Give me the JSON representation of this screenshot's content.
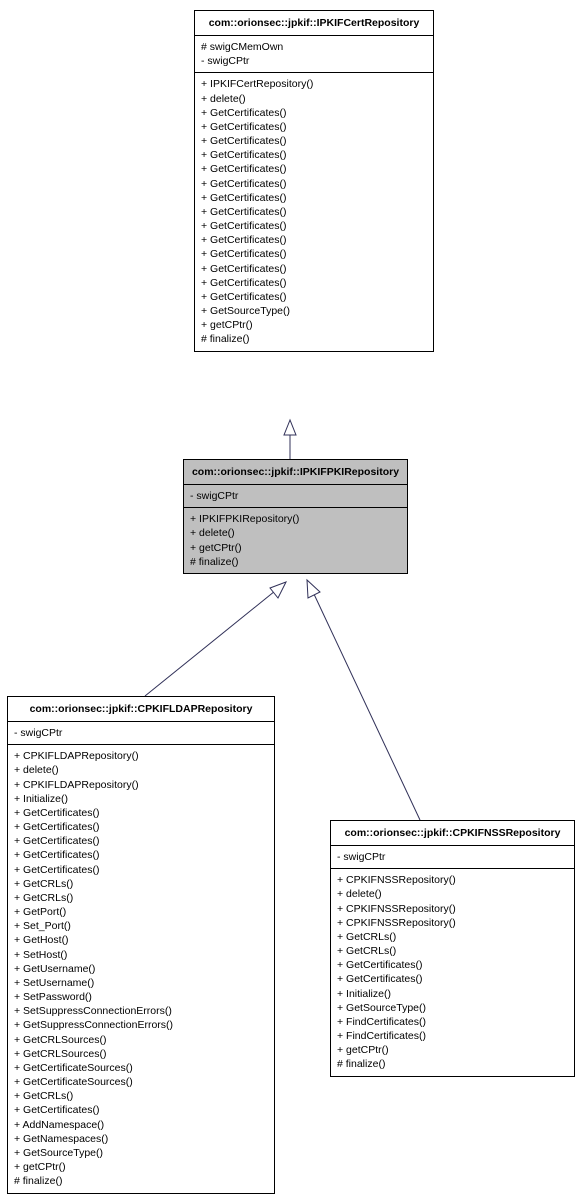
{
  "top": {
    "title": "com::orionsec::jpkif::IPKIFCertRepository",
    "attrs": [
      "# swigCMemOwn",
      "- swigCPtr"
    ],
    "ops": [
      "+ IPKIFCertRepository()",
      "+ delete()",
      "+ GetCertificates()",
      "+ GetCertificates()",
      "+ GetCertificates()",
      "+ GetCertificates()",
      "+ GetCertificates()",
      "+ GetCertificates()",
      "+ GetCertificates()",
      "+ GetCertificates()",
      "+ GetCertificates()",
      "+ GetCertificates()",
      "+ GetCertificates()",
      "+ GetCertificates()",
      "+ GetCertificates()",
      "+ GetCertificates()",
      "+ GetSourceType()",
      "+ getCPtr()",
      "# finalize()"
    ]
  },
  "mid": {
    "title": "com::orionsec::jpkif::IPKIFPKIRepository",
    "attrs": [
      "- swigCPtr"
    ],
    "ops": [
      "+ IPKIFPKIRepository()",
      "+ delete()",
      "+ getCPtr()",
      "# finalize()"
    ]
  },
  "left": {
    "title": "com::orionsec::jpkif::CPKIFLDAPRepository",
    "attrs": [
      "- swigCPtr"
    ],
    "ops": [
      "+ CPKIFLDAPRepository()",
      "+ delete()",
      "+ CPKIFLDAPRepository()",
      "+ Initialize()",
      "+ GetCertificates()",
      "+ GetCertificates()",
      "+ GetCertificates()",
      "+ GetCertificates()",
      "+ GetCertificates()",
      "+ GetCRLs()",
      "+ GetCRLs()",
      "+ GetPort()",
      "+ Set_Port()",
      "+ GetHost()",
      "+ SetHost()",
      "+ GetUsername()",
      "+ SetUsername()",
      "+ SetPassword()",
      "+ SetSuppressConnectionErrors()",
      "+ GetSuppressConnectionErrors()",
      "+ GetCRLSources()",
      "+ GetCRLSources()",
      "+ GetCertificateSources()",
      "+ GetCertificateSources()",
      "+ GetCRLs()",
      "+ GetCertificates()",
      "+ AddNamespace()",
      "+ GetNamespaces()",
      "+ GetSourceType()",
      "+ getCPtr()",
      "# finalize()"
    ]
  },
  "right": {
    "title": "com::orionsec::jpkif::CPKIFNSSRepository",
    "attrs": [
      "- swigCPtr"
    ],
    "ops": [
      "+ CPKIFNSSRepository()",
      "+ delete()",
      "+ CPKIFNSSRepository()",
      "+ CPKIFNSSRepository()",
      "+ GetCRLs()",
      "+ GetCRLs()",
      "+ GetCertificates()",
      "+ GetCertificates()",
      "+ Initialize()",
      "+ GetSourceType()",
      "+ FindCertificates()",
      "+ FindCertificates()",
      "+ getCPtr()",
      "# finalize()"
    ]
  }
}
